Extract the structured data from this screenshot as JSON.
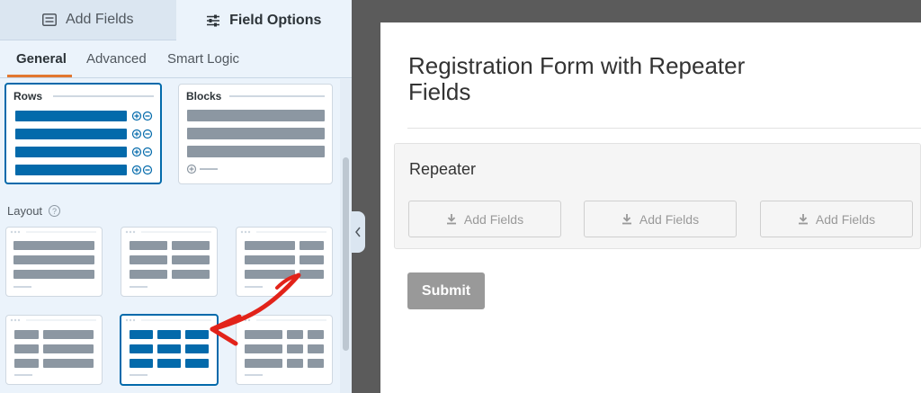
{
  "top_tabs": [
    {
      "label": "Add Fields",
      "icon": "list-icon"
    },
    {
      "label": "Field Options",
      "icon": "sliders-icon"
    }
  ],
  "sub_tabs": [
    "General",
    "Advanced",
    "Smart Logic"
  ],
  "display_options": [
    {
      "label": "Rows",
      "selected": true
    },
    {
      "label": "Blocks",
      "selected": false
    }
  ],
  "layout": {
    "label": "Layout",
    "help_icon": "help-icon",
    "options_count": 6,
    "selected_option": 5
  },
  "form": {
    "title": "Registration Form with Repeater Fields",
    "repeater_label": "Repeater",
    "add_fields": [
      "Add Fields",
      "Add Fields",
      "Add Fields"
    ],
    "submit_label": "Submit"
  },
  "colors": {
    "accent_blue": "#036aab",
    "tab_underline": "#e27730",
    "annotation_arrow": "#e2231a",
    "placeholder_gray": "#8c97a2"
  }
}
